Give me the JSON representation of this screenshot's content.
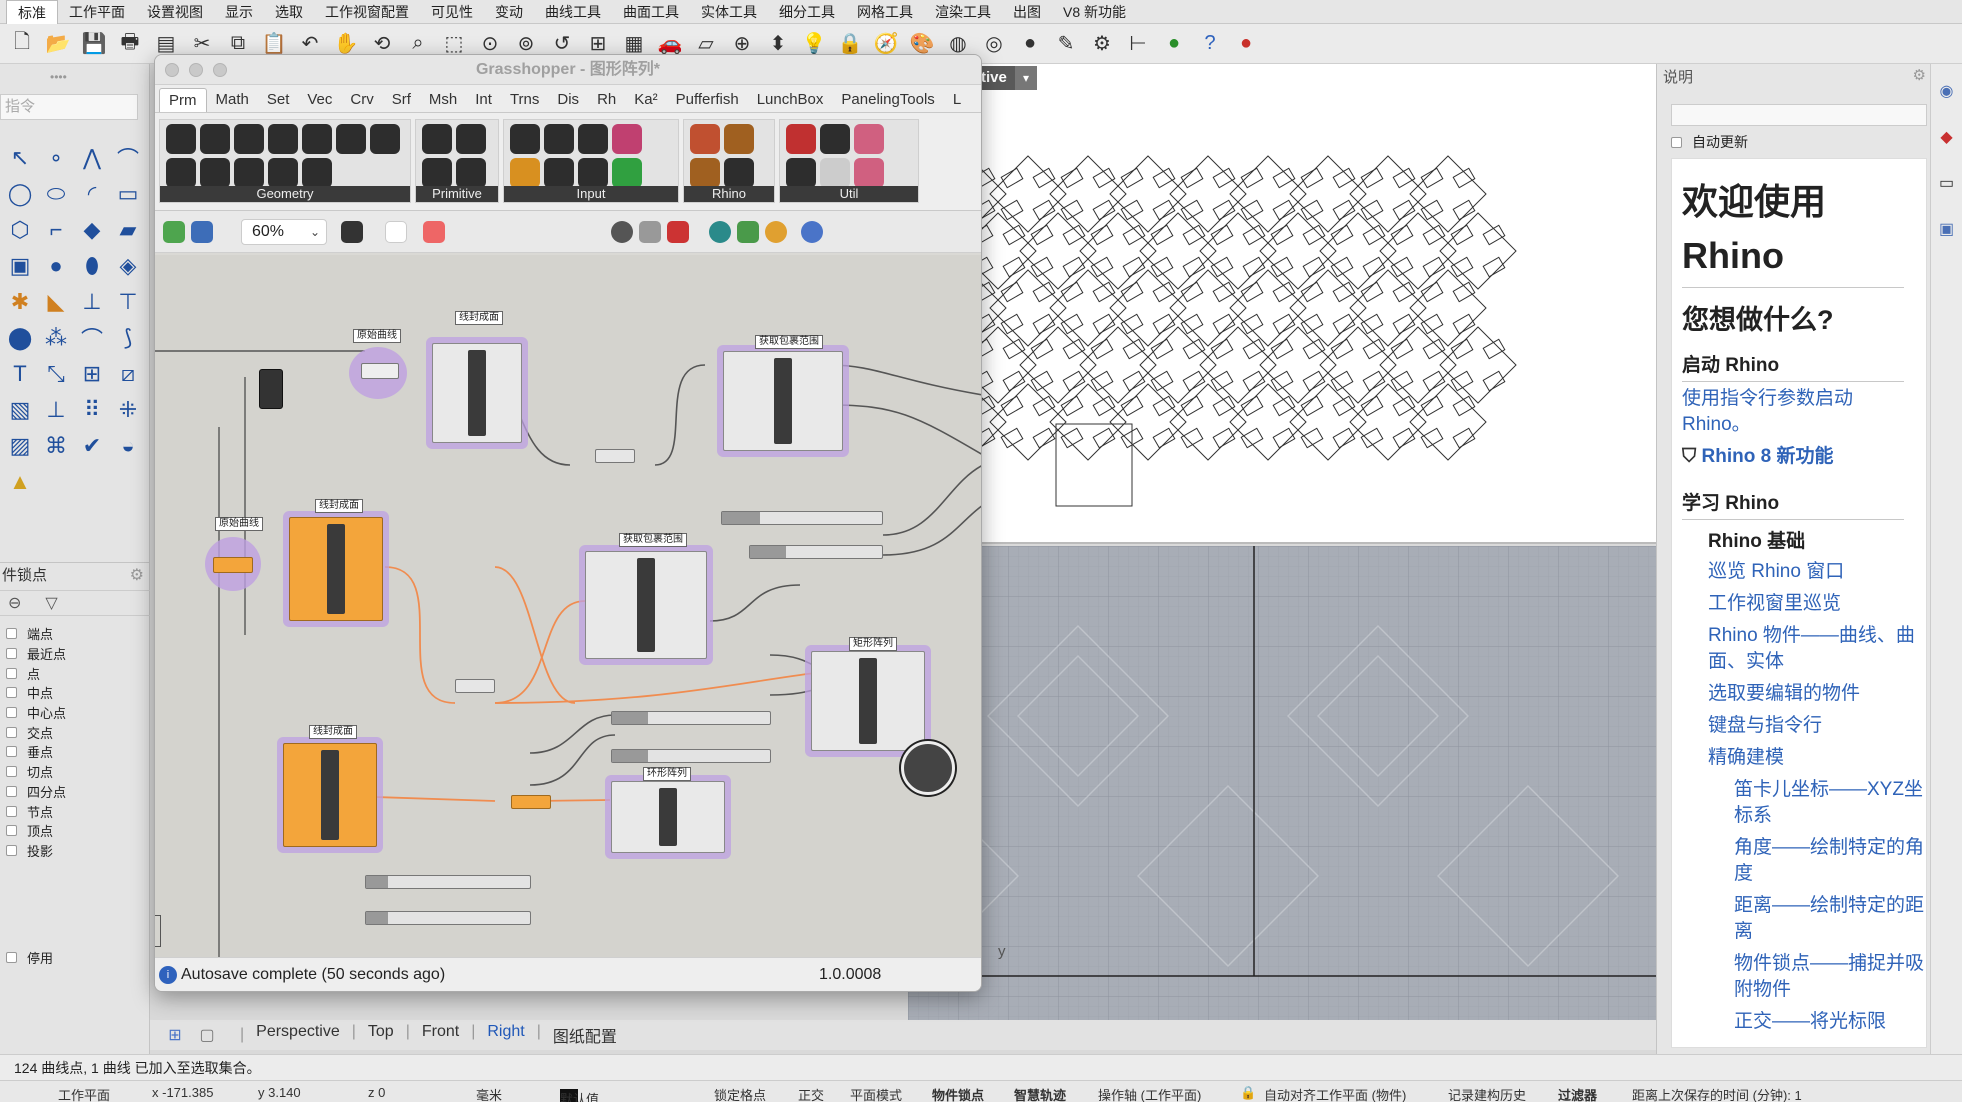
{
  "menu": [
    "标准",
    "工作平面",
    "设置视图",
    "显示",
    "选取",
    "工作视窗配置",
    "可见性",
    "变动",
    "曲线工具",
    "曲面工具",
    "实体工具",
    "细分工具",
    "网格工具",
    "渲染工具",
    "出图",
    "V8 新功能"
  ],
  "left": {
    "command_placeholder": "指令",
    "osnap_title": "件锁点",
    "osnaps": [
      "端点",
      "最近点",
      "点",
      "中点",
      "中心点",
      "交点",
      "垂点",
      "切点",
      "四分点",
      "节点",
      "顶点",
      "投影"
    ],
    "disable": "停用"
  },
  "viewport": {
    "active_label": "tive",
    "axis_label": "y"
  },
  "viewport_tabs": [
    "Perspective",
    "Top",
    "Front",
    "Right",
    "图纸配置"
  ],
  "active_viewport_tab": "Right",
  "grasshopper": {
    "title": "Grasshopper - 图形阵列*",
    "tabs": [
      "Prm",
      "Math",
      "Set",
      "Vec",
      "Crv",
      "Srf",
      "Msh",
      "Int",
      "Trns",
      "Dis",
      "Rh",
      "Ka²",
      "Pufferfish",
      "LunchBox",
      "PanelingTools",
      "L"
    ],
    "ribbon_groups": [
      "Geometry",
      "Primitive",
      "Input",
      "Rhino",
      "Util"
    ],
    "zoom": "60%",
    "status_message": "Autosave complete (50 seconds ago)",
    "version": "1.0.0008",
    "component_labels": {
      "c1": "线封成面",
      "c2": "获取包裹范围",
      "c3": "线封成面",
      "c4": "获取包裹范围",
      "c5": "矩形阵列",
      "c6": "线封成面",
      "c7": "环形阵列",
      "p1": "原始曲线",
      "p2": "原始曲线"
    }
  },
  "command_history": "124 曲线点, 1 曲线 已加入至选取集合。",
  "status": {
    "plane": "工作平面",
    "x": "x -171.385",
    "y": "y 3.140",
    "z": "z 0",
    "units": "毫米",
    "layer": "默认值",
    "grid_snap": "锁定格点",
    "ortho": "正交",
    "planar": "平面模式",
    "osnap": "物件锁点",
    "smarttrack": "智慧轨迹",
    "gumball": "操作轴 (工作平面)",
    "autoalign": "自动对齐工作平面 (物件)",
    "history": "记录建构历史",
    "filter": "过滤器",
    "save_time": "距离上次保存的时间 (分钟): 1"
  },
  "help_panel": {
    "title": "说明",
    "auto_update": "自动更新",
    "welcome_line1": "欢迎使用",
    "welcome_line2": "Rhino",
    "what_to_do": "您想做什么?",
    "start_heading": "启动 Rhino",
    "start_link": "使用指令行参数启动 Rhino。",
    "new_features": "Rhino 8 新功能",
    "learn_heading": "学习 Rhino",
    "basics": "Rhino 基础",
    "links_l1": [
      "巡览 Rhino 窗口",
      "工作视窗里巡览",
      "Rhino 物件——曲线、曲面、实体",
      "选取要编辑的物件",
      "键盘与指令行",
      "精确建模"
    ],
    "links_l2": [
      "笛卡儿坐标——XYZ坐标系",
      "角度——绘制特定的角度",
      "距离——绘制特定的距离",
      "物件锁点——捕捉并吸附物件",
      "正交——将光标限"
    ]
  },
  "colors": {
    "link": "#2f63b8",
    "gh_orange": "#f3a53b",
    "gh_select": "#bea0e1",
    "wire_orange": "#f08c50"
  }
}
